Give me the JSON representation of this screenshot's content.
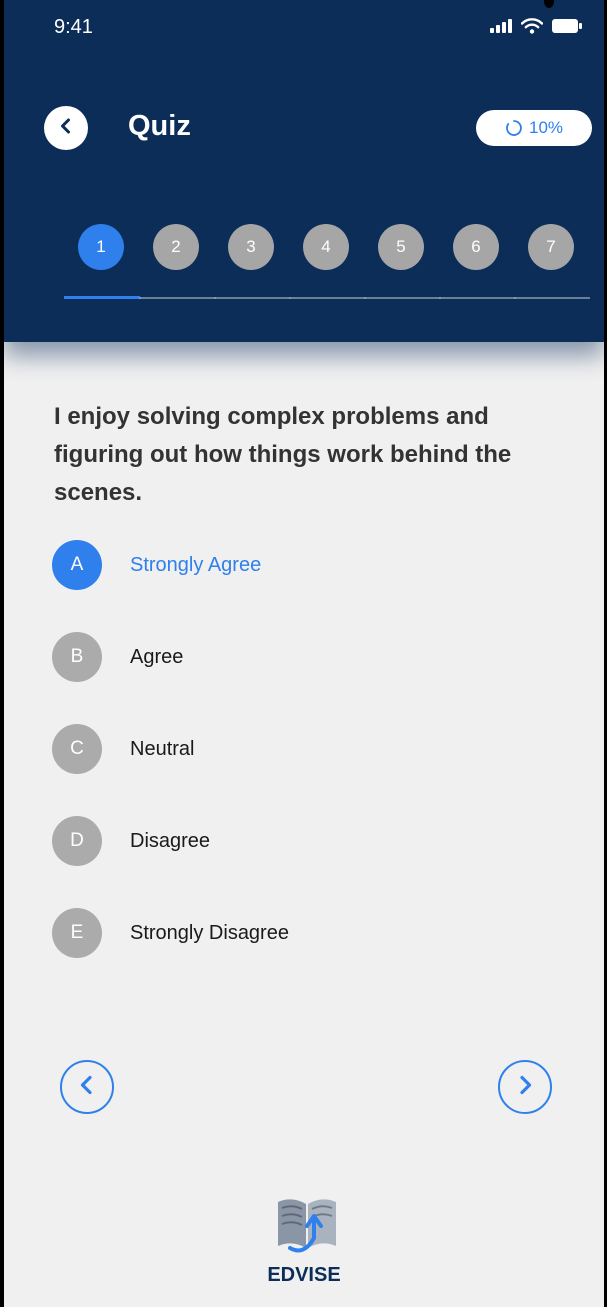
{
  "status_bar": {
    "time": "9:41"
  },
  "header": {
    "title": "Quiz",
    "progress": "10%",
    "progress_fraction": 0.1
  },
  "steps": {
    "items": [
      "1",
      "2",
      "3",
      "4",
      "5",
      "6",
      "7"
    ],
    "active_index": 0
  },
  "question": {
    "text": "I enjoy solving complex problems and figuring out how things work behind the scenes."
  },
  "options": [
    {
      "letter": "A",
      "label": "Strongly Agree",
      "selected": true
    },
    {
      "letter": "B",
      "label": "Agree",
      "selected": false
    },
    {
      "letter": "C",
      "label": "Neutral",
      "selected": false
    },
    {
      "letter": "D",
      "label": "Disagree",
      "selected": false
    },
    {
      "letter": "E",
      "label": "Strongly Disagree",
      "selected": false
    }
  ],
  "brand": {
    "name": "EDVISE"
  },
  "colors": {
    "header_bg": "#0c2d58",
    "accent": "#2f80ed",
    "inactive": "#a6a6a6",
    "page_bg": "#f0f0f0"
  },
  "icons": {
    "back": "chevron-left-icon",
    "progress": "loading-ring-icon",
    "prev": "chevron-left-icon",
    "next": "chevron-right-icon",
    "logo": "open-book-icon"
  }
}
